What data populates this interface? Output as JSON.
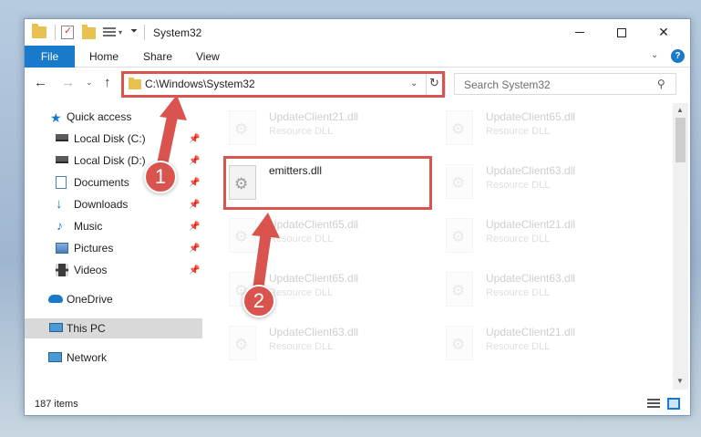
{
  "window": {
    "title": "System32",
    "min_glyph": "",
    "close_glyph": "✕"
  },
  "ribbon": {
    "tabs": [
      {
        "label": "File"
      },
      {
        "label": "Home"
      },
      {
        "label": "Share"
      },
      {
        "label": "View"
      }
    ],
    "help": "?"
  },
  "navbar": {
    "address": "C:\\Windows\\System32",
    "search_placeholder": "Search System32"
  },
  "sidebar": {
    "items": [
      {
        "label": "Quick access",
        "icon": "star-icon"
      },
      {
        "label": "Local Disk (C:)",
        "icon": "drive-icon",
        "pinned": true
      },
      {
        "label": "Local Disk (D:)",
        "icon": "drive-icon",
        "pinned": true
      },
      {
        "label": "Documents",
        "icon": "documents-icon",
        "pinned": true
      },
      {
        "label": "Downloads",
        "icon": "downloads-icon",
        "pinned": true
      },
      {
        "label": "Music",
        "icon": "music-icon",
        "pinned": true
      },
      {
        "label": "Pictures",
        "icon": "pictures-icon",
        "pinned": true
      },
      {
        "label": "Videos",
        "icon": "videos-icon",
        "pinned": true
      },
      {
        "label": "OneDrive",
        "icon": "onedrive-icon"
      },
      {
        "label": "This PC",
        "icon": "computer-icon",
        "selected": true
      },
      {
        "label": "Network",
        "icon": "network-icon"
      }
    ]
  },
  "files": {
    "highlighted": {
      "name": "emitters.dll"
    },
    "background": [
      {
        "name": "UpdateClient21.dll",
        "type": "Resource DLL"
      },
      {
        "name": "UpdateClient65.dll",
        "type": "Resource DLL"
      },
      {
        "name": "UpdateClient63.dll",
        "type": "Resource DLL"
      },
      {
        "name": "UpdateClient65.dll",
        "type": "Resource DLL"
      },
      {
        "name": "UpdateClient21.dll",
        "type": "Resource DLL"
      },
      {
        "name": "UpdateClient65.dll",
        "type": "Resource DLL"
      },
      {
        "name": "UpdateClient63.dll",
        "type": "Resource DLL"
      },
      {
        "name": "UpdateClient63.dll",
        "type": "Resource DLL"
      },
      {
        "name": "UpdateClient21.dll",
        "type": "Resource DLL"
      }
    ]
  },
  "status": {
    "item_count": "187 items"
  },
  "annotations": {
    "step1": "1",
    "step2": "2",
    "color": "#d9534f"
  }
}
